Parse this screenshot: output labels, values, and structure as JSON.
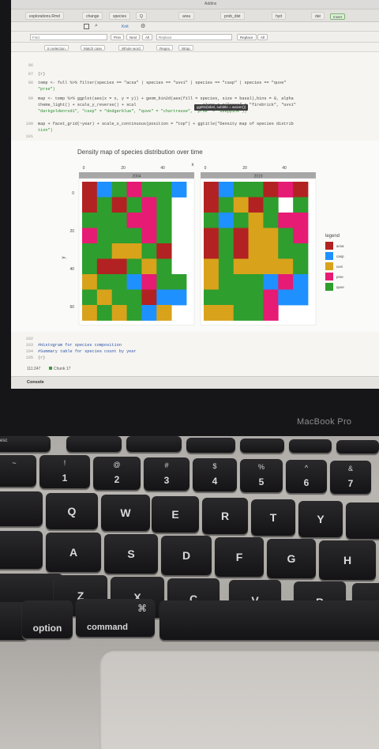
{
  "app": {
    "address_label": "Addins",
    "project": "explorations.Rmd",
    "tabs": [
      "change",
      "species",
      "Q",
      "area",
      "prob_dist",
      "hyd",
      "dat"
    ],
    "insert_label": "Insert",
    "knit_label": "Knit",
    "find": {
      "placeholder": "Find",
      "prev": "Prev",
      "next": "Next",
      "all": "All",
      "replace_placeholder": "Replace",
      "replace": "Replace",
      "replace_all": "All"
    },
    "options": [
      "In selection",
      "Match case",
      "Whole word",
      "Regex",
      "Wrap"
    ]
  },
  "editor": {
    "line_numbers": [
      "96",
      "97",
      "98",
      "",
      "99",
      "",
      "",
      "100",
      "",
      "101"
    ],
    "lines": [
      "",
      "{r}",
      "temp <- full %>% filter(species == \"acsa\" | species == \"uvvi\" | species == \"casp\" | species == \"quve\"",
      "\"prse\")",
      "map <- temp %>% ggplot(aes(x = x, y = y)) + geom_bin2d(aes(fill = species, size = basal),bins = 8, alpha",
      "theme_light() + scale_y_reverse() + scal                           alues = c(\"acsa\" = \"firebrick\", \"uvvi\"",
      "\"darkgoldenrod1\", \"casp\" = \"dodgerblue\", \"quve\" = \"chartreuse\", \"prse\" = \"deeppink\"))",
      "map + facet_grid(~year) + scale_x_continuous(position = \"top\") + ggtitle(\"Density map of species distrib",
      "tion\")",
      ""
    ],
    "tooltip": "ggtitle(label, subtitle = waiver())"
  },
  "lower": {
    "line_numbers": [
      "102",
      "103",
      "104",
      "105"
    ],
    "lines": [
      "",
      "#Histogram for species composition",
      "#Summary table for species count by year",
      "{r}"
    ],
    "status_pos": "111:247",
    "status_chunk": "Chunk 17"
  },
  "console_label": "Console",
  "brand": "MacBook Pro",
  "chart_data": {
    "type": "heatmap",
    "title": "Density map of species distribution over time",
    "xlabel": "x",
    "ylabel": "y",
    "x_ticks": [
      "0",
      "20",
      "40"
    ],
    "y_ticks": [
      "0",
      "20",
      "40",
      "60"
    ],
    "facets": [
      "2004",
      "2019"
    ],
    "legend_title": "legend",
    "legend": [
      {
        "name": "acsa",
        "color": "#b22222"
      },
      {
        "name": "casp",
        "color": "#1e90ff"
      },
      {
        "name": "uvvi",
        "color": "#d9a21b"
      },
      {
        "name": "prse",
        "color": "#e61b74"
      },
      {
        "name": "quve",
        "color": "#2e9e2e"
      }
    ],
    "grids": [
      [
        [
          "acsa",
          "casp",
          "quve",
          "prse",
          "quve",
          "quve",
          "casp",
          ""
        ],
        [
          "acsa",
          "quve",
          "acsa",
          "quve",
          "prse",
          "quve",
          "",
          ""
        ],
        [
          "quve",
          "quve",
          "quve",
          "prse",
          "prse",
          "quve",
          "",
          ""
        ],
        [
          "prse",
          "quve",
          "quve",
          "quve",
          "prse",
          "quve",
          "",
          ""
        ],
        [
          "quve",
          "quve",
          "uvvi",
          "uvvi",
          "quve",
          "acsa",
          "",
          ""
        ],
        [
          "quve",
          "acsa",
          "acsa",
          "quve",
          "uvvi",
          "quve",
          "",
          ""
        ],
        [
          "uvvi",
          "quve",
          "quve",
          "casp",
          "prse",
          "quve",
          "quve",
          ""
        ],
        [
          "quve",
          "uvvi",
          "quve",
          "quve",
          "acsa",
          "casp",
          "casp",
          ""
        ],
        [
          "uvvi",
          "quve",
          "uvvi",
          "quve",
          "casp",
          "uvvi",
          "",
          ""
        ]
      ],
      [
        [
          "acsa",
          "casp",
          "quve",
          "quve",
          "acsa",
          "prse",
          "acsa",
          ""
        ],
        [
          "acsa",
          "quve",
          "uvvi",
          "acsa",
          "quve",
          "",
          "quve",
          ""
        ],
        [
          "quve",
          "casp",
          "quve",
          "uvvi",
          "quve",
          "prse",
          "prse",
          ""
        ],
        [
          "acsa",
          "quve",
          "acsa",
          "uvvi",
          "uvvi",
          "quve",
          "prse",
          ""
        ],
        [
          "acsa",
          "quve",
          "acsa",
          "uvvi",
          "uvvi",
          "quve",
          "quve",
          ""
        ],
        [
          "uvvi",
          "quve",
          "uvvi",
          "uvvi",
          "uvvi",
          "uvvi",
          "quve",
          ""
        ],
        [
          "uvvi",
          "quve",
          "quve",
          "quve",
          "casp",
          "prse",
          "casp",
          ""
        ],
        [
          "quve",
          "quve",
          "quve",
          "quve",
          "prse",
          "casp",
          "casp",
          ""
        ],
        [
          "uvvi",
          "uvvi",
          "quve",
          "quve",
          "prse",
          "",
          "",
          ""
        ]
      ]
    ]
  },
  "keyboard": {
    "fn_row": [
      "esc",
      "",
      "",
      "",
      "",
      "",
      "",
      "",
      ""
    ],
    "num_row": [
      [
        "~",
        "`"
      ],
      [
        "!",
        "1"
      ],
      [
        "@",
        "2"
      ],
      [
        "#",
        "3"
      ],
      [
        "$",
        "4"
      ],
      [
        "%",
        "5"
      ],
      [
        "^",
        "6"
      ],
      [
        "&",
        "7"
      ]
    ],
    "q_row": [
      "Q",
      "W",
      "E",
      "R",
      "T",
      "Y"
    ],
    "a_row": [
      "A",
      "S",
      "D",
      "F",
      "G",
      "H"
    ],
    "z_row": [
      "Z",
      "X",
      "C",
      "V",
      "B"
    ],
    "option": "option",
    "command": "command",
    "command_symbol": "⌘"
  }
}
